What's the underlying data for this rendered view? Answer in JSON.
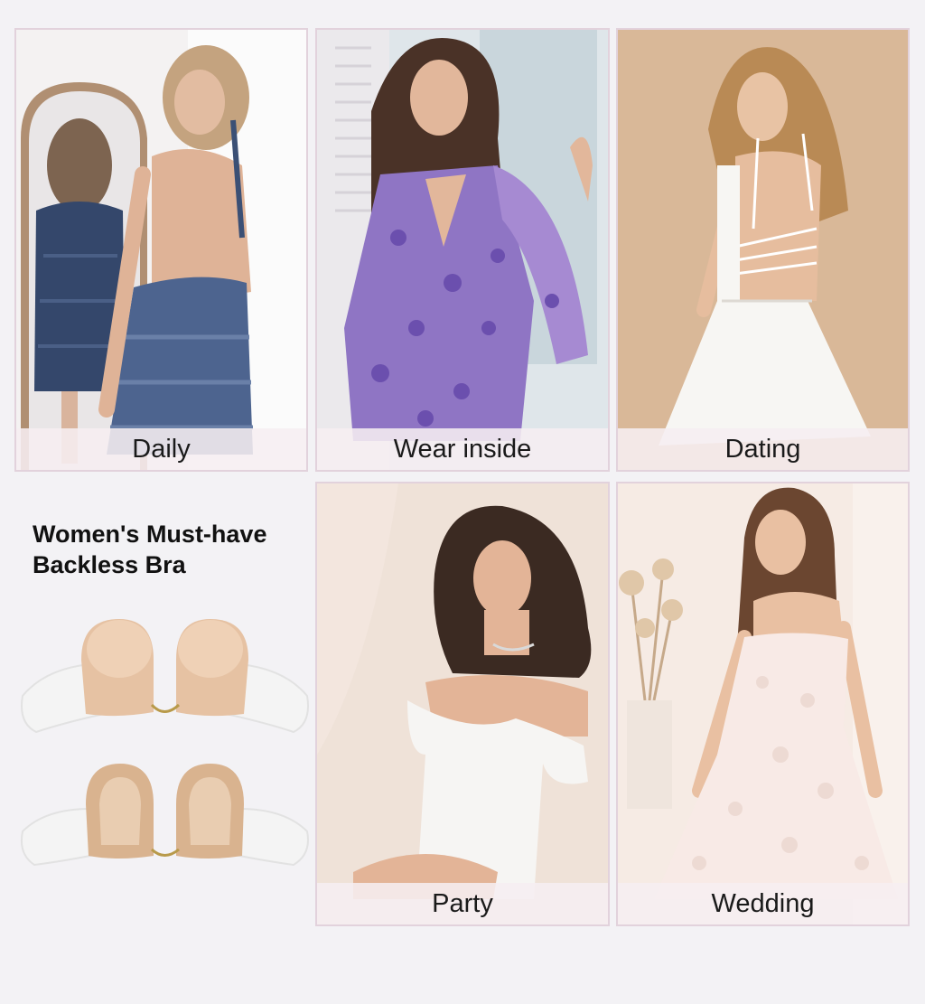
{
  "tiles": [
    {
      "id": "daily",
      "caption": "Daily",
      "scene": "woman-in-blue-halter-backless-dress"
    },
    {
      "id": "wear-inside",
      "caption": "Wear inside",
      "scene": "woman-in-purple-floral-dress"
    },
    {
      "id": "dating",
      "caption": "Dating",
      "scene": "woman-in-white-strappy-backless-dress"
    },
    {
      "id": "party",
      "caption": "Party",
      "scene": "woman-in-white-off-shoulder-dress"
    },
    {
      "id": "wedding",
      "caption": "Wedding",
      "scene": "woman-in-white-lace-strapless-gown"
    }
  ],
  "headline": {
    "line1": "Women's Must-have",
    "line2": "Backless Bra"
  },
  "products": [
    {
      "view": "front",
      "icon": "adhesive-bra-front-icon"
    },
    {
      "view": "back",
      "icon": "adhesive-bra-back-icon"
    }
  ],
  "colors": {
    "background": "#f3f2f5",
    "caption_bg": "#f6eef1",
    "tile_border": "#e2d2dc",
    "bra_skin": "#e9c8ad",
    "bra_wing": "#f4f4f4"
  }
}
